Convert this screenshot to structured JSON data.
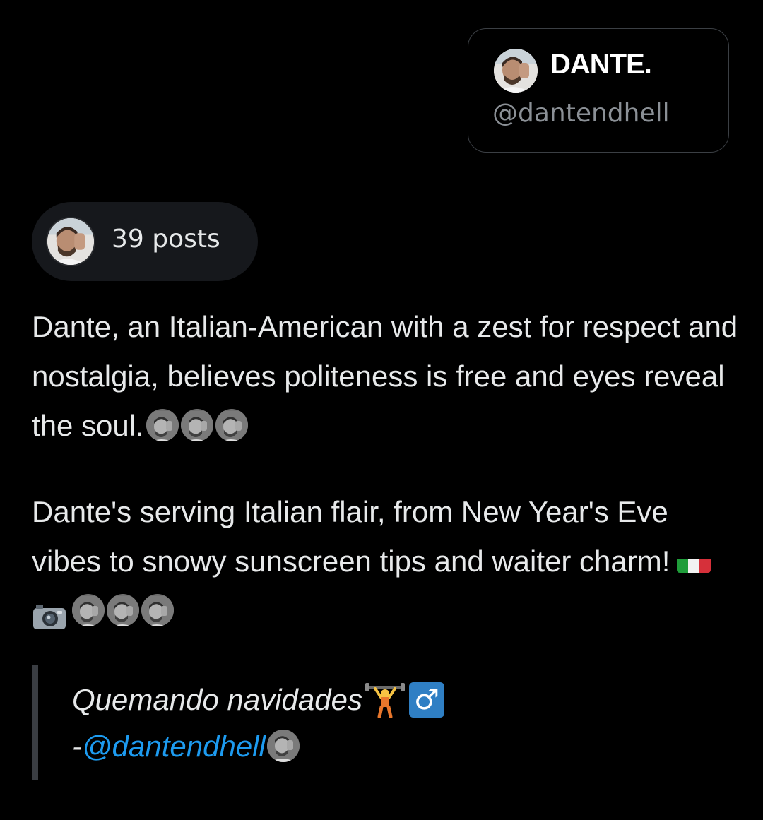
{
  "profile_card": {
    "display_name": "DANTE.",
    "handle": "@dantendhell",
    "avatar": "avatar-photo"
  },
  "posts_pill": {
    "count_label": "39 posts",
    "avatar": "avatar-photo"
  },
  "bio": {
    "paragraph_1": "Dante, an Italian-American with a zest for respect and nostalgia, believes politeness is free and eyes reveal the soul.",
    "paragraph_2": "Dante's serving Italian flair, from New Year's Eve vibes to snowy sunscreen tips and waiter charm!",
    "icons": [
      "face-emoji-icon",
      "italy-flag-icon",
      "camera-icon"
    ]
  },
  "quote": {
    "line_1": "Quemando navidades",
    "dash": "-",
    "mention": "@dantendhell",
    "male_sign": "♂",
    "icons": [
      "weightlifter-icon",
      "male-sign-icon",
      "face-emoji-icon"
    ]
  },
  "colors": {
    "background": "#000000",
    "text": "#e7e9ea",
    "muted": "#8b9096",
    "link": "#1d9bf0",
    "pill_bg": "#16181c"
  }
}
